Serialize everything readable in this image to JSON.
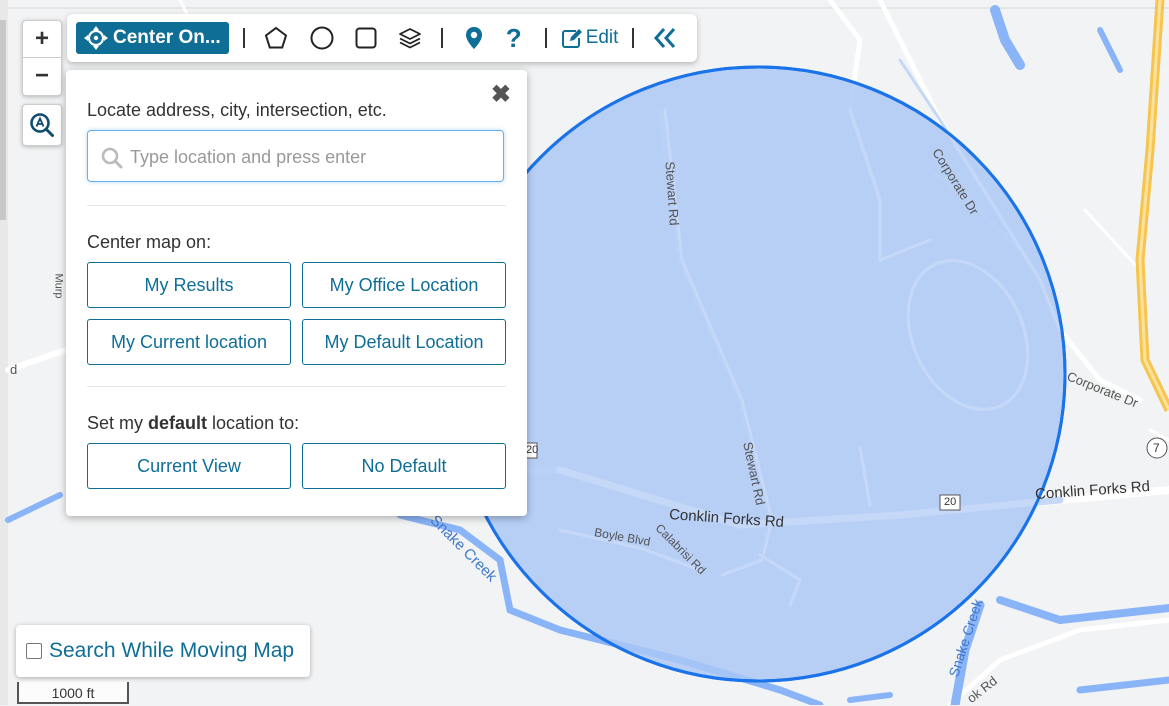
{
  "map": {
    "labels": {
      "stewart_rd_north": "Stewart Rd",
      "stewart_rd_south": "Stewart Rd",
      "corporate_dr_north": "Corporate Dr",
      "corporate_dr_east": "Corporate Dr",
      "conklin_forks_center": "Conklin Forks Rd",
      "conklin_forks_east": "Conklin Forks Rd",
      "boyle_blvd": "Boyle Blvd",
      "calabrisi_rd": "Calabrisi Rd",
      "snake_creek_west": "Snake Creek",
      "snake_creek_east": "Snake Creek",
      "route_20_left": "20",
      "route_20_right": "20",
      "route_7": "7",
      "left_road_fragment": "d",
      "left_vertical_fragment": "Murp",
      "bottom_road_fragment": "ok Rd"
    },
    "colors": {
      "circle_fill": "#a9c6f5",
      "circle_stroke": "#1a73e8",
      "water": "#8ab4f8",
      "highway": "#f6c550",
      "accent": "#0f6e96"
    }
  },
  "zoom": {
    "in": "+",
    "out": "−"
  },
  "toolbar": {
    "center_label": "Center On...",
    "edit_label": "Edit",
    "icons": [
      "crosshair-icon",
      "polygon-icon",
      "circle-icon",
      "square-icon",
      "layers-icon",
      "map-pin-icon",
      "help-icon",
      "edit-icon",
      "collapse-icon"
    ]
  },
  "panel": {
    "close": "✖",
    "locate_label": "Locate address, city, intersection, etc.",
    "search_placeholder": "Type location and press enter",
    "search_value": "",
    "center_label": "Center map on:",
    "buttons": {
      "my_results": "My Results",
      "my_office": "My Office Location",
      "my_current": "My Current location",
      "my_default": "My Default Location"
    },
    "default_prefix": "Set my ",
    "default_bold": "default",
    "default_suffix": " location to:",
    "default_buttons": {
      "current_view": "Current View",
      "no_default": "No Default"
    }
  },
  "search_while_moving": {
    "label": "Search While Moving Map",
    "checked": false
  },
  "scale": {
    "label": "1000 ft"
  }
}
